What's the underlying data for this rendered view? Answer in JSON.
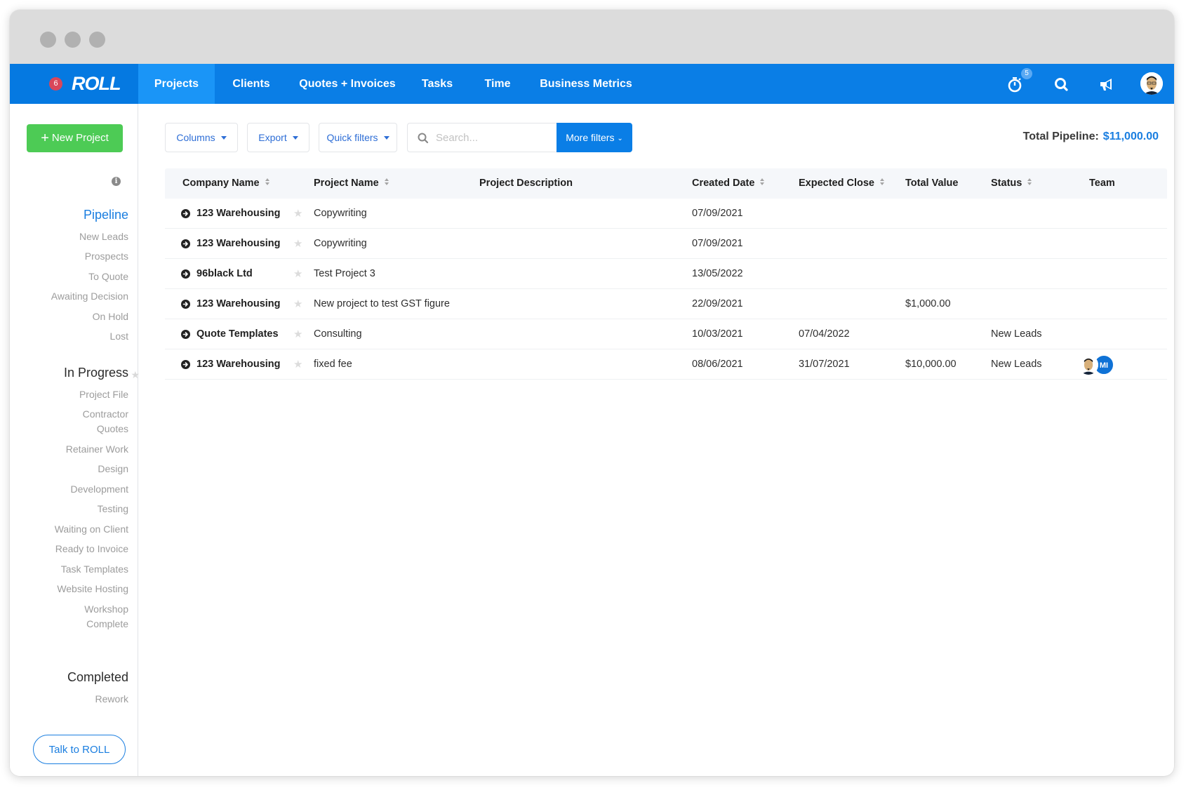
{
  "nav": {
    "notification_count": "6",
    "logo": "ROLL",
    "tabs": [
      {
        "label": "Projects",
        "active": true
      },
      {
        "label": "Clients",
        "active": false
      },
      {
        "label": "Quotes + Invoices",
        "active": false
      },
      {
        "label": "Tasks",
        "active": false
      },
      {
        "label": "Time",
        "active": false
      },
      {
        "label": "Business Metrics",
        "active": false
      }
    ],
    "timer_badge": "5",
    "icons": [
      "stopwatch-icon",
      "search-icon",
      "megaphone-icon",
      "user-avatar"
    ]
  },
  "sidebar": {
    "new_project_label": "New Project",
    "pipeline": {
      "heading": "Pipeline",
      "items": [
        "New Leads",
        "Prospects",
        "To Quote",
        "Awaiting Decision",
        "On Hold",
        "Lost"
      ]
    },
    "in_progress": {
      "heading": "In Progress",
      "items": [
        "Project File",
        "Contractor Quotes",
        "Retainer Work",
        "Design",
        "Development",
        "Testing",
        "Waiting on Client",
        "Ready to Invoice",
        "Task Templates",
        "Website Hosting",
        "Workshop Complete"
      ]
    },
    "completed": {
      "heading": "Completed",
      "items": [
        "Rework"
      ]
    },
    "talk_label": "Talk to ROLL"
  },
  "toolbar": {
    "columns_label": "Columns",
    "export_label": "Export",
    "quick_filters_label": "Quick filters",
    "search_placeholder": "Search...",
    "search_value": "",
    "more_filters_label": "More filters",
    "total_pipeline_label": "Total Pipeline:",
    "total_pipeline_value": "$11,000.00"
  },
  "table": {
    "headers": {
      "company": "Company Name",
      "project": "Project Name",
      "description": "Project Description",
      "created": "Created Date",
      "expected": "Expected Close",
      "value": "Total Value",
      "status": "Status",
      "team": "Team"
    },
    "rows": [
      {
        "company": "123 Warehousing",
        "project": "Copywriting",
        "description": "",
        "created": "07/09/2021",
        "expected": "",
        "value": "",
        "status": "",
        "team": []
      },
      {
        "company": "123 Warehousing",
        "project": "Copywriting",
        "description": "",
        "created": "07/09/2021",
        "expected": "",
        "value": "",
        "status": "",
        "team": []
      },
      {
        "company": "96black Ltd",
        "project": "Test Project 3",
        "description": "",
        "created": "13/05/2022",
        "expected": "",
        "value": "",
        "status": "",
        "team": []
      },
      {
        "company": "123 Warehousing",
        "project": "New project to test GST figure",
        "description": "",
        "created": "22/09/2021",
        "expected": "",
        "value": "$1,000.00",
        "status": "",
        "team": []
      },
      {
        "company": "Quote Templates",
        "project": "Consulting",
        "description": "",
        "created": "10/03/2021",
        "expected": "07/04/2022",
        "value": "",
        "status": "New Leads",
        "team": []
      },
      {
        "company": "123 Warehousing",
        "project": "fixed fee",
        "description": "",
        "created": "08/06/2021",
        "expected": "31/07/2021",
        "value": "$10,000.00",
        "status": "New Leads",
        "team": [
          "avatar",
          "MI"
        ]
      }
    ]
  },
  "colors": {
    "nav_blue": "#0a7ee6",
    "active_tab": "#1a95f7",
    "accent_blue": "#1a7ee0",
    "green": "#4dcb55",
    "badge_red": "#d9465a"
  }
}
